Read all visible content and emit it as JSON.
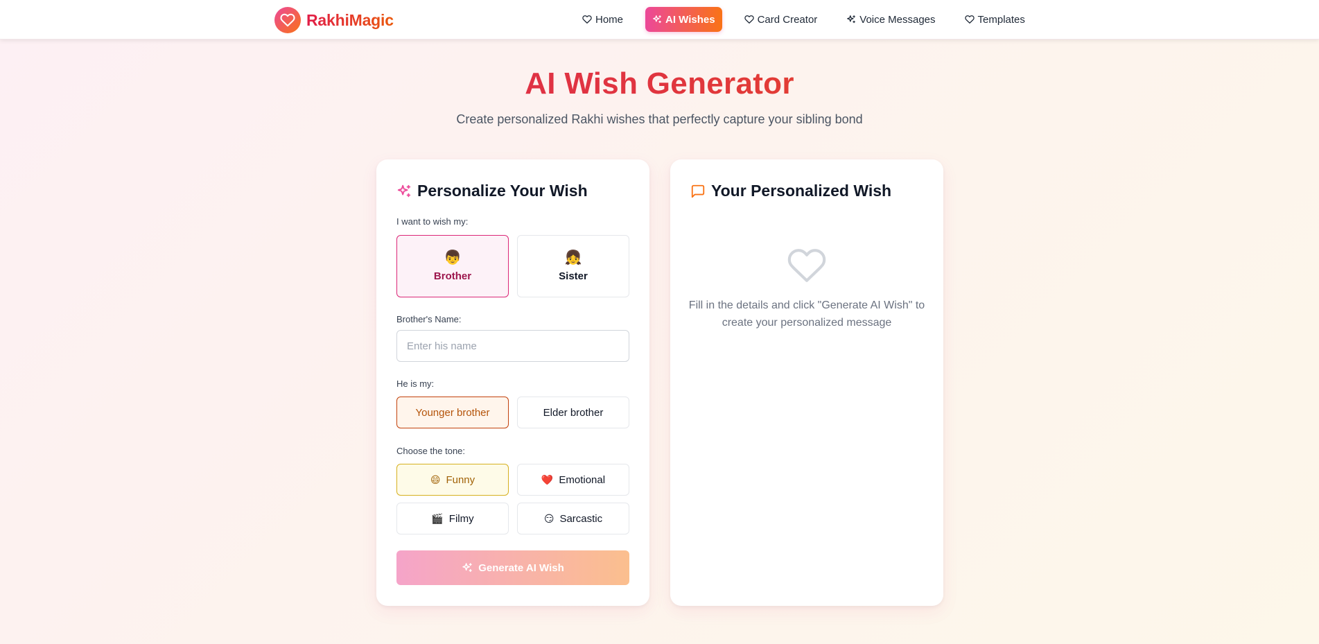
{
  "brand": {
    "name": "RakhiMagic"
  },
  "nav": {
    "items": [
      {
        "label": "Home",
        "icon": "heart-icon",
        "active": false
      },
      {
        "label": "AI Wishes",
        "icon": "sparkles-icon",
        "active": true
      },
      {
        "label": "Card Creator",
        "icon": "heart-icon",
        "active": false
      },
      {
        "label": "Voice Messages",
        "icon": "sparkles-icon",
        "active": false
      },
      {
        "label": "Templates",
        "icon": "heart-icon",
        "active": false
      }
    ]
  },
  "hero": {
    "title": "AI Wish Generator",
    "subtitle": "Create personalized Rakhi wishes that perfectly capture your sibling bond"
  },
  "form": {
    "heading": "Personalize Your Wish",
    "wish_label": "I want to wish my:",
    "sibling_options": [
      {
        "label": "Brother",
        "emoji": "👦",
        "selected": true
      },
      {
        "label": "Sister",
        "emoji": "👧",
        "selected": false
      }
    ],
    "name_label": "Brother's Name:",
    "name_placeholder": "Enter his name",
    "name_value": "",
    "relation_label": "He is my:",
    "relation_options": [
      {
        "label": "Younger brother",
        "selected": true
      },
      {
        "label": "Elder brother",
        "selected": false
      }
    ],
    "tone_label": "Choose the tone:",
    "tone_options": [
      {
        "label": "Funny",
        "emoji": "😄",
        "selected": true
      },
      {
        "label": "Emotional",
        "emoji": "❤️",
        "selected": false
      },
      {
        "label": "Filmy",
        "emoji": "🎬",
        "selected": false
      },
      {
        "label": "Sarcastic",
        "emoji": "😏",
        "selected": false
      }
    ],
    "generate_label": "Generate AI Wish"
  },
  "result": {
    "heading": "Your Personalized Wish",
    "empty_message": "Fill in the details and click \"Generate AI Wish\" to create your personalized message"
  },
  "colors": {
    "accent_pink": "#ec4899",
    "accent_orange": "#f97316",
    "title_red": "#e0353f"
  }
}
